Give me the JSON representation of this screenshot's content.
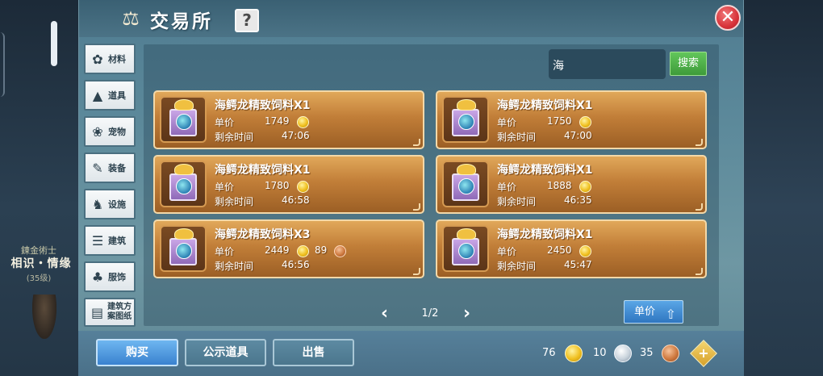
{
  "header": {
    "title": "交易所",
    "help_label": "?",
    "close_label": "✕"
  },
  "background": {
    "npc_title": "鍊金術士",
    "npc_name": "相识・情缘",
    "npc_level": "(35级)"
  },
  "sidebar": {
    "items": [
      {
        "label": "材料",
        "icon": "materials-icon"
      },
      {
        "label": "道具",
        "icon": "item-icon"
      },
      {
        "label": "宠物",
        "icon": "paw-icon"
      },
      {
        "label": "装备",
        "icon": "equipment-icon"
      },
      {
        "label": "设施",
        "icon": "facility-icon"
      },
      {
        "label": "建筑",
        "icon": "building-icon"
      },
      {
        "label": "服饰",
        "icon": "clothing-icon"
      },
      {
        "label": "建筑方案图纸",
        "icon": "blueprint-icon"
      }
    ]
  },
  "search": {
    "value": "海",
    "button_label": "搜索"
  },
  "labels": {
    "unit_price": "单价",
    "remaining_time": "剩余时间"
  },
  "listings": [
    {
      "name": "海鳄龙精致饲料X1",
      "price": "1749",
      "time": "47:06"
    },
    {
      "name": "海鳄龙精致饲料X1",
      "price": "1750",
      "time": "47:00"
    },
    {
      "name": "海鳄龙精致饲料X1",
      "price": "1780",
      "time": "46:58"
    },
    {
      "name": "海鳄龙精致饲料X1",
      "price": "1888",
      "time": "46:35"
    },
    {
      "name": "海鳄龙精致饲料X3",
      "price": "2449",
      "price_extra": "89",
      "time": "46:56"
    },
    {
      "name": "海鳄龙精致饲料X1",
      "price": "2450",
      "time": "45:47"
    }
  ],
  "pagination": {
    "prev": "‹",
    "page": "1/2",
    "next": "›",
    "sort_label": "单价",
    "sort_arrow": "⇧"
  },
  "bottom": {
    "buy_label": "购买",
    "public_label": "公示道具",
    "sell_label": "出售",
    "gold": "76",
    "silver": "10",
    "copper": "35",
    "add_label": "+"
  }
}
